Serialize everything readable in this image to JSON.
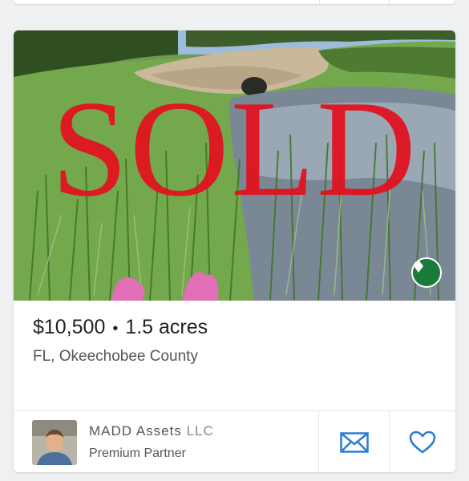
{
  "listing": {
    "overlay_text": "SOLD",
    "price": "$10,500",
    "separator": "•",
    "acreage": "1.5 acres",
    "location": "FL, Okeechobee County",
    "badge_icon": "diamond-icon"
  },
  "agent": {
    "name": "MADD Assets",
    "suffix": "LLC",
    "role": "Premium Partner"
  },
  "actions": {
    "contact_icon": "envelope-icon",
    "favorite_icon": "heart-icon"
  },
  "colors": {
    "sold_red": "#e3101e",
    "badge_green": "#1a7a3a",
    "action_blue": "#2d7fd0"
  }
}
